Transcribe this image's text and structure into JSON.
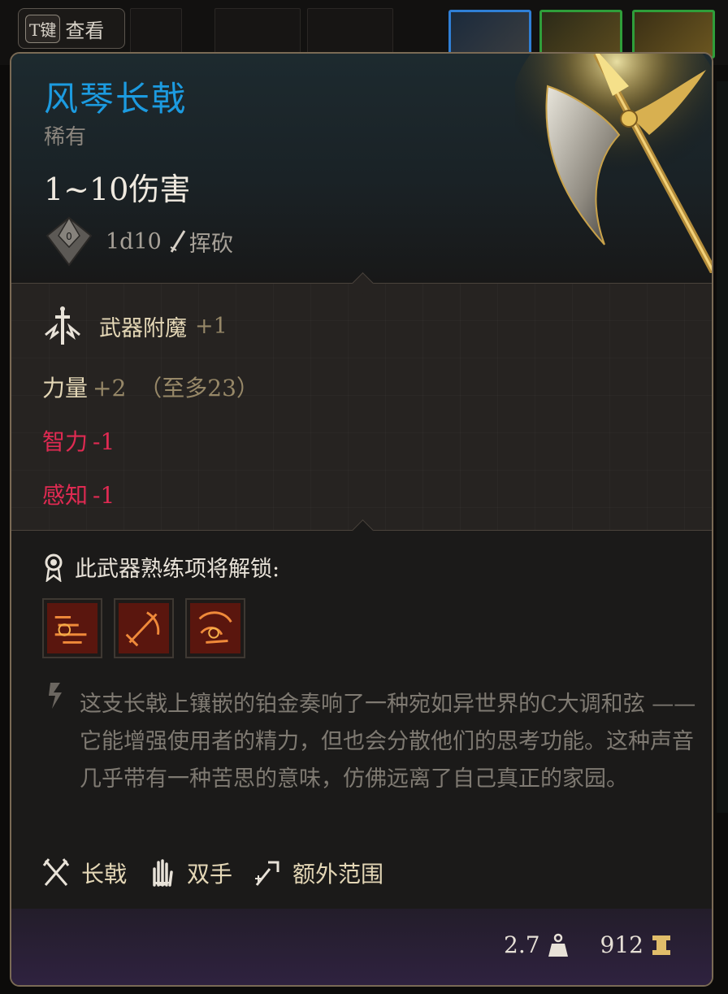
{
  "top_bar": {
    "key_hint": "T键",
    "key_action": "查看"
  },
  "item": {
    "name": "风琴长戟",
    "rarity": "稀有",
    "damage": "1~10伤害",
    "damage_dice": "1d10",
    "damage_type": "挥砍",
    "enchantment_label": "武器附魔",
    "enchantment_value": "+1",
    "stats": [
      {
        "name": "力量",
        "value": "+2",
        "cap": "（至多23）"
      },
      {
        "name": "智力",
        "value": "-1"
      },
      {
        "name": "感知",
        "value": "-1"
      }
    ],
    "proficiency_label": "此武器熟练项将解锁:",
    "abilities": [
      "ability-icon-1",
      "ability-icon-2",
      "ability-icon-3"
    ],
    "description": "这支长戟上镶嵌的铂金奏响了一种宛如异世界的C大调和弦 —— 它能增强使用者的精力，但也会分散他们的思考功能。这种声音几乎带有一种苦思的意味，仿佛远离了自己真正的家园。",
    "tags": [
      {
        "icon": "halberd-icon",
        "label": "长戟"
      },
      {
        "icon": "two-handed-icon",
        "label": "双手"
      },
      {
        "icon": "reach-icon",
        "label": "额外范围"
      }
    ],
    "weight": "2.7",
    "value": "912"
  },
  "colors": {
    "name": "#1c9be0",
    "negative": "#e02a52",
    "gold": "#e4d7b6",
    "border": "#7a6a55"
  }
}
